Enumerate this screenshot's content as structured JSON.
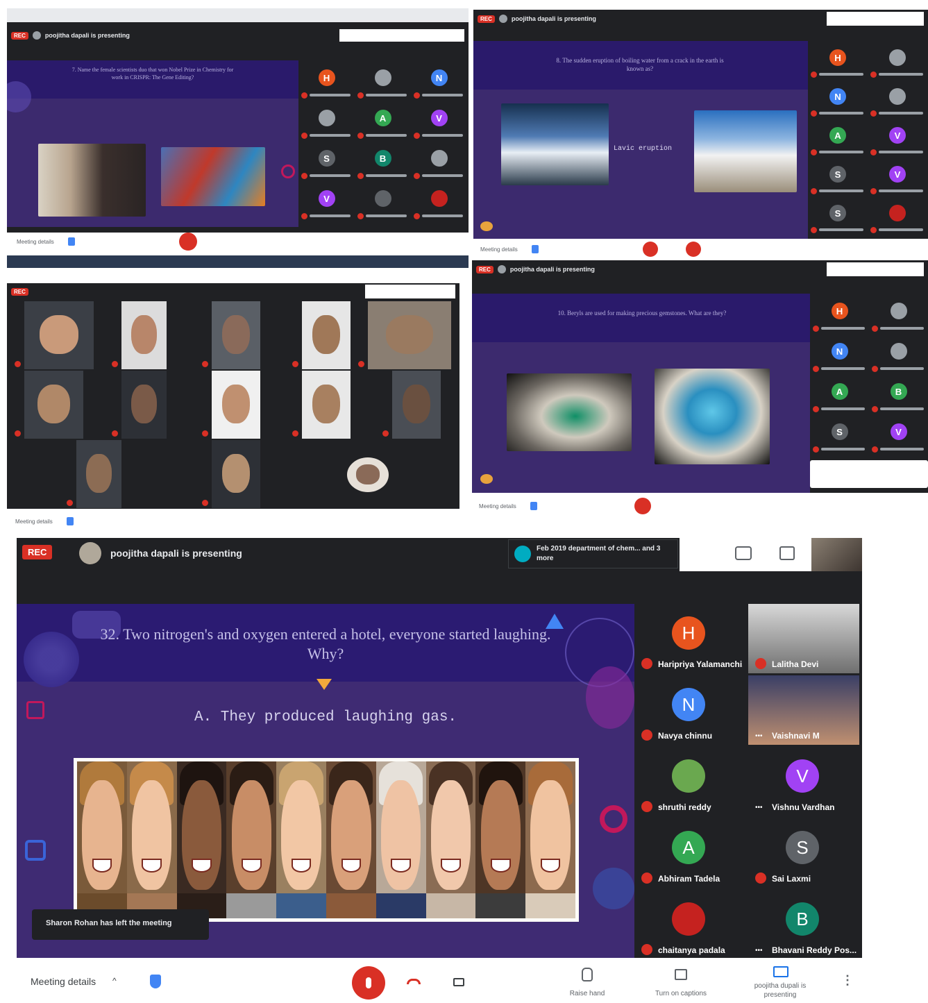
{
  "panel_top_left": {
    "rec_label": "REC",
    "presenter_text": "poojitha dapali is presenting",
    "question": "7. Name the female scientists duo that won Nobel Prize in Chemistry for work in CRISPR: The Gene Editing?",
    "meeting_details_label": "Meeting details",
    "participants": [
      {
        "letter": "H",
        "color": "#e8541e"
      },
      {
        "letter": "",
        "color": "#9aa0a6"
      },
      {
        "letter": "N",
        "color": "#4285f4"
      },
      {
        "letter": "",
        "color": "#9aa0a6"
      },
      {
        "letter": "A",
        "color": "#34a853"
      },
      {
        "letter": "V",
        "color": "#a142f4"
      },
      {
        "letter": "S",
        "color": "#5f6368"
      },
      {
        "letter": "B",
        "color": "#12866b"
      },
      {
        "letter": "",
        "color": "#9aa0a6"
      },
      {
        "letter": "V",
        "color": "#a142f4"
      },
      {
        "letter": "",
        "color": "#5f6368"
      },
      {
        "letter": "",
        "color": "#c5221f"
      }
    ]
  },
  "panel_top_right": {
    "rec_label": "REC",
    "presenter_text": "poojitha dapali is presenting",
    "question": "8. The sudden eruption of boiling water from a crack in the earth is known as?",
    "answer": "Lavic eruption",
    "meeting_details_label": "Meeting details",
    "participants": [
      {
        "letter": "H",
        "color": "#e8541e"
      },
      {
        "letter": "",
        "color": "#9aa0a6"
      },
      {
        "letter": "N",
        "color": "#4285f4"
      },
      {
        "letter": "",
        "color": "#9aa0a6"
      },
      {
        "letter": "A",
        "color": "#34a853"
      },
      {
        "letter": "V",
        "color": "#a142f4"
      },
      {
        "letter": "S",
        "color": "#5f6368"
      },
      {
        "letter": "V",
        "color": "#a142f4"
      },
      {
        "letter": "S",
        "color": "#5f6368"
      },
      {
        "letter": "",
        "color": "#c5221f"
      }
    ]
  },
  "panel_mid_left": {
    "rec_label": "REC",
    "meeting_details_label": "Meeting details"
  },
  "panel_mid_right": {
    "rec_label": "REC",
    "presenter_text": "poojitha dapali is presenting",
    "question": "10. Beryls are used for making precious gemstones. What are they?",
    "meeting_details_label": "Meeting details",
    "participants": [
      {
        "letter": "H",
        "color": "#e8541e"
      },
      {
        "letter": "",
        "color": "#9aa0a6"
      },
      {
        "letter": "N",
        "color": "#4285f4"
      },
      {
        "letter": "",
        "color": "#9aa0a6"
      },
      {
        "letter": "A",
        "color": "#34a853"
      },
      {
        "letter": "B",
        "color": "#34a853"
      },
      {
        "letter": "S",
        "color": "#5f6368"
      },
      {
        "letter": "V",
        "color": "#a142f4"
      }
    ]
  },
  "main": {
    "rec_label": "REC",
    "presenter_text": "poojitha dapali is presenting",
    "chat_notice": "Feb 2019 department of chem... and 3 more",
    "question": "32. Two nitrogen's and oxygen entered a hotel, everyone started laughing. Why?",
    "answer": "A. They produced laughing gas.",
    "left_notice": "Sharon Rohan has left the meeting",
    "participants": [
      {
        "name": "Haripriya Yalamanchi...",
        "letter": "H",
        "color": "#e8541e",
        "muted": true
      },
      {
        "name": "Lalitha Devi",
        "letter": "",
        "color": "#9aa0a6",
        "muted": true
      },
      {
        "name": "Navya chinnu",
        "letter": "N",
        "color": "#4285f4",
        "muted": true
      },
      {
        "name": "Vaishnavi M",
        "letter": "",
        "color": "#9aa0a6",
        "muted": false
      },
      {
        "name": "shruthi reddy",
        "letter": "",
        "color": "#6aa84f",
        "muted": true
      },
      {
        "name": "Vishnu Vardhan",
        "letter": "V",
        "color": "#a142f4",
        "muted": false
      },
      {
        "name": "Abhiram Tadela",
        "letter": "A",
        "color": "#34a853",
        "muted": true
      },
      {
        "name": "Sai Laxmi",
        "letter": "S",
        "color": "#5f6368",
        "muted": true
      },
      {
        "name": "chaitanya padala",
        "letter": "",
        "color": "#c5221f",
        "muted": true
      },
      {
        "name": "Bhavani Reddy Pos...",
        "letter": "B",
        "color": "#12866b",
        "muted": false
      }
    ]
  },
  "bottom_bar": {
    "meeting_details_label": "Meeting details",
    "raise_hand_label": "Raise hand",
    "captions_label": "Turn on captions",
    "presenting_label": "poojitha dupali is presenting"
  },
  "colors": {
    "slide_bg": "#3f2b73",
    "slide_band": "#2b1b72",
    "meet_dark": "#202124",
    "end_call_red": "#d93025"
  }
}
